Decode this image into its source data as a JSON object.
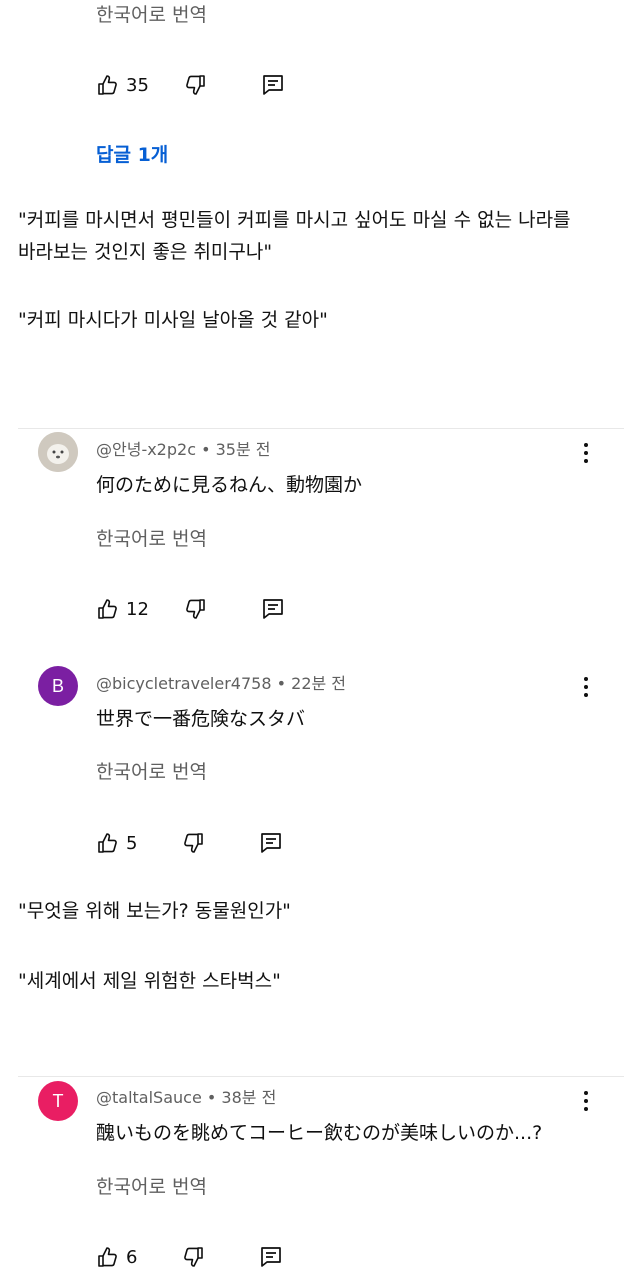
{
  "top_comment": {
    "translate_label": "한국어로 번역",
    "like_count": "35",
    "replies_label": "답글 1개"
  },
  "caption_1": {
    "lines": [
      "\"커피를 마시면서 평민들이 커피를 마시고 싶어도 마실 수 없는 나라를",
      "바라보는 것인지 좋은 취미구나\"",
      "\"커피 마시다가 미사일 날아올 것 같아\""
    ]
  },
  "comments": [
    {
      "avatar_letter": "",
      "avatar_color": "#d9d4cc",
      "author": "@안녕-x2p2c",
      "time": "35분 전",
      "text": "何のために見るねん、動物園か",
      "translate_label": "한국어로 번역",
      "like_count": "12"
    },
    {
      "avatar_letter": "B",
      "avatar_color": "#7b1fa2",
      "author": "@bicycletraveler4758",
      "time": "22분 전",
      "text": "世界で一番危険なスタバ",
      "translate_label": "한국어로 번역",
      "like_count": "5"
    },
    {
      "avatar_letter": "T",
      "avatar_color": "#e91e63",
      "author": "@taltalSauce",
      "time": "38분 전",
      "text": "醜いものを眺めてコーヒー飲むのが美味しいのか...?",
      "translate_label": "한국어로 번역",
      "like_count": "6"
    }
  ],
  "caption_2": {
    "lines": [
      "\"무엇을 위해 보는가? 동물원인가\"",
      "\"세계에서 제일 위험한 스타벅스\""
    ]
  },
  "meta_separator": "•",
  "icons": {
    "like": "thumbs-up-icon",
    "dislike": "thumbs-down-icon",
    "reply": "reply-icon",
    "more": "more-vert-icon",
    "avatar_image": "dog-avatar-icon"
  },
  "colors": {
    "link": "#065fd4",
    "secondary_text": "#606060"
  }
}
